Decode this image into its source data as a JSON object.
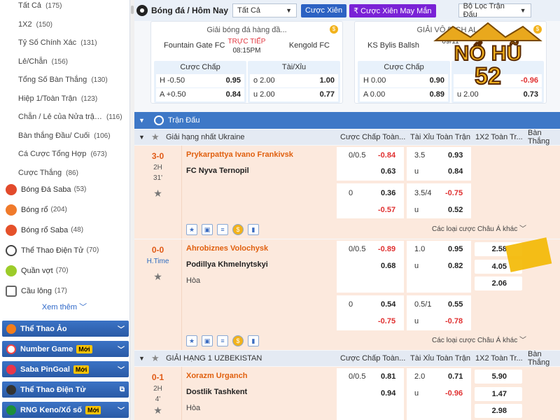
{
  "sidebar": {
    "sub_items": [
      {
        "label": "Tất Cả",
        "count": "(175)"
      },
      {
        "label": "1X2",
        "count": "(150)"
      },
      {
        "label": "Tỷ Số Chính Xác",
        "count": "(131)"
      },
      {
        "label": "Lẻ/Chẵn",
        "count": "(156)"
      },
      {
        "label": "Tổng Số Bàn Thắng",
        "count": "(130)"
      },
      {
        "label": "Hiệp 1/Toàn Trận",
        "count": "(123)"
      },
      {
        "label": "Chẵn / Lẻ của Nửa trậ…",
        "count": "(116)"
      },
      {
        "label": "Bàn thắng Đầu/ Cuối",
        "count": "(106)"
      },
      {
        "label": "Cá Cược Tổng Hợp",
        "count": "(673)"
      },
      {
        "label": "Cược Thắng",
        "count": "(86)"
      }
    ],
    "sports": [
      {
        "label": "Bóng Đá Saba",
        "count": "(53)",
        "color": "#e24a2b"
      },
      {
        "label": "Bóng rổ",
        "count": "(204)",
        "color": "#f07a2b"
      },
      {
        "label": "Bóng rổ Saba",
        "count": "(48)",
        "color": "#e5512a"
      },
      {
        "label": "Thể Thao Điện Tử",
        "count": "(70)",
        "color": "#444444"
      },
      {
        "label": "Quần vợt",
        "count": "(70)",
        "color": "#9ccc2a"
      },
      {
        "label": "Cầu lông",
        "count": "(17)",
        "color": "#666666"
      }
    ],
    "more": "Xem thêm ﹀",
    "virtual": [
      {
        "label": "Thể Thao Ảo",
        "tag": "",
        "icon_color": "#f27d1c",
        "chev": "﹀"
      },
      {
        "label": "Number Game",
        "tag": "Mới",
        "icon_color": "#ffffff",
        "chev": "﹀"
      },
      {
        "label": "Saba PinGoal",
        "tag": "Mới",
        "icon_color": "#e8364a",
        "chev": "﹀"
      },
      {
        "label": "Thể Thao Điện Tử",
        "tag": "",
        "icon_color": "#333333",
        "chev": "⧉"
      },
      {
        "label": "RNG Keno/Xổ số",
        "tag": "Mới",
        "icon_color": "#1c8f3b",
        "chev": "﹀"
      }
    ]
  },
  "topbar": {
    "crumb": "Bóng đá / Hôm Nay",
    "filter_value": "Tất Cả",
    "parlay_btn": "Cược Xiên",
    "parlay_lucky_btn": "₹ Cược Xiên May Mắn",
    "match_filter": "Bộ Lọc Trận Đấu"
  },
  "cards": [
    {
      "league": "Giải bóng đá hàng đầ...",
      "home": "Fountain Gate FC",
      "away": "Kengold FC",
      "live": "TRỰC TIẾP",
      "time": "08:15PM",
      "hc_title": "Cược Chấp",
      "ou_title": "Tài/Xỉu",
      "hc": [
        {
          "k": "H -0.50",
          "v": "0.95"
        },
        {
          "k": "A +0.50",
          "v": "0.84"
        }
      ],
      "ou": [
        {
          "k": "o 2.00",
          "v": "1.00"
        },
        {
          "k": "u 2.00",
          "v": "0.77"
        }
      ]
    },
    {
      "league": "GIẢI VÔ ĐỊCH AL...",
      "home": "KS Bylis Ballsh",
      "away": "",
      "live": "09/11",
      "time": "",
      "hc_title": "Cược Chấp",
      "ou_title": "",
      "hc": [
        {
          "k": "H 0.00",
          "v": "0.90"
        },
        {
          "k": "A 0.00",
          "v": "0.89"
        }
      ],
      "ou": [
        {
          "k": "",
          "v": "-0.96"
        },
        {
          "k": "u 2.00",
          "v": "0.73"
        }
      ]
    }
  ],
  "logo": {
    "line1": "NỔ HŨ",
    "line2": "52"
  },
  "section": {
    "title": "Trận Đấu"
  },
  "leagues": [
    {
      "name": "Giải hạng nhất Ukraine",
      "cols": [
        "Cược Chấp Toàn...",
        "Tài Xỉu Toàn Trận",
        "1X2 Toàn Tr...",
        "Bàn Thắng"
      ]
    },
    {
      "name": "GIẢI HẠNG 1 UZBEKISTAN",
      "cols": [
        "Cược Chấp Toàn...",
        "Tài Xỉu Toàn Trận",
        "1X2 Toàn Tr...",
        "Bàn Thắng"
      ]
    }
  ],
  "matches": [
    {
      "score": "3-0",
      "status1": "2H",
      "status2": "31'",
      "home": "Prykarpattya Ivano Frankivsk",
      "away": "FC Nyva Ternopil",
      "draw": "",
      "rows": [
        {
          "hc_line": "0/0.5",
          "hc_h": "-0.84",
          "hc_a": "0.63",
          "ou_line": "3.5",
          "ou_o": "0.93",
          "ou_u": "0.84"
        },
        {
          "hc_line": "0",
          "hc_h": "0.36",
          "hc_a": "-0.57",
          "ou_line": "3.5/4",
          "ou_o": "-0.75",
          "ou_u": "0.52"
        }
      ],
      "x12": [],
      "more": "Các loại cược Châu Á khác ﹀"
    },
    {
      "score": "0-0",
      "status1": "H.Time",
      "status2": "",
      "home": "Ahrobiznes Volochysk",
      "away": "Podillya Khmelnytskyi",
      "draw": "Hòa",
      "rows": [
        {
          "hc_line": "0/0.5",
          "hc_h": "-0.89",
          "hc_a": "0.68",
          "ou_line": "1.0",
          "ou_o": "0.95",
          "ou_u": "0.82"
        },
        {
          "hc_line": "0",
          "hc_h": "0.54",
          "hc_a": "-0.75",
          "ou_line": "0.5/1",
          "ou_o": "0.55",
          "ou_u": "-0.78"
        }
      ],
      "x12": [
        "2.58",
        "4.05",
        "2.06"
      ],
      "more": "Các loại cược Châu Á khác ﹀"
    },
    {
      "score": "0-1",
      "status1": "2H",
      "status2": "4'",
      "home": "Xorazm Urganch",
      "away": "Dostlik Tashkent",
      "draw": "Hòa",
      "rows": [
        {
          "hc_line": "0/0.5",
          "hc_h": "0.81",
          "hc_a": "0.94",
          "ou_line": "2.0",
          "ou_o": "0.71",
          "ou_u": "-0.96"
        }
      ],
      "x12": [
        "5.90",
        "1.47",
        "2.98"
      ],
      "more": ""
    }
  ],
  "u_label": "u"
}
